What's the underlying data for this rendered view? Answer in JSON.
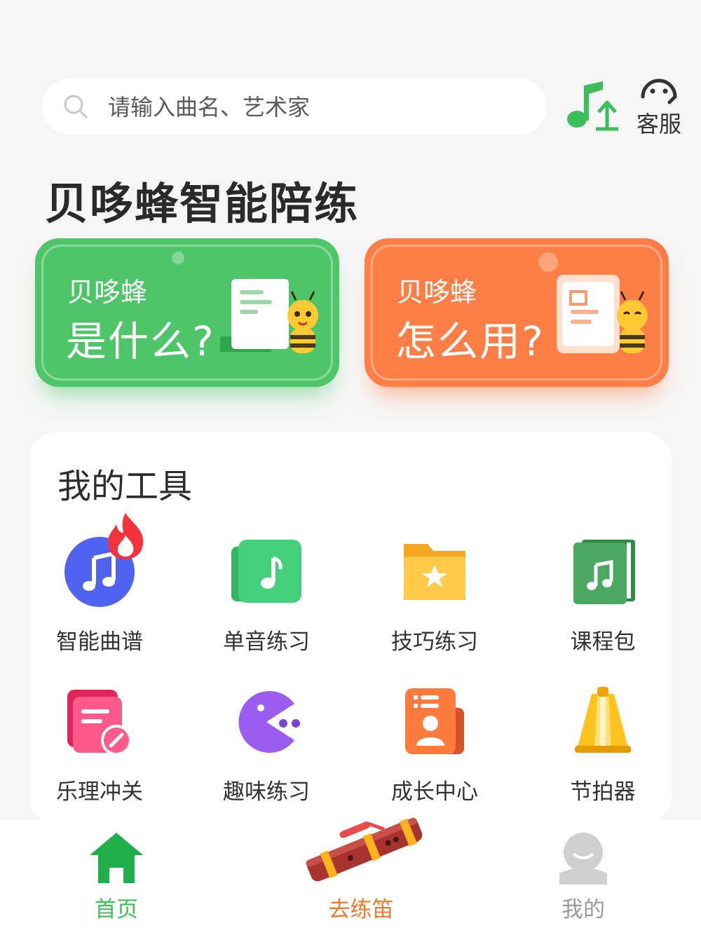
{
  "search": {
    "placeholder": "请输入曲名、艺术家"
  },
  "header": {
    "customer_service_label": "客服"
  },
  "page_title": "贝哆蜂智能陪练",
  "promo_cards": [
    {
      "sub": "贝哆蜂",
      "main": "是什么?",
      "color": "#4fc56a"
    },
    {
      "sub": "贝哆蜂",
      "main": "怎么用?",
      "color": "#ff7e45"
    }
  ],
  "tools": {
    "title": "我的工具",
    "items": [
      {
        "label": "智能曲谱",
        "icon": "music-note-hot-icon"
      },
      {
        "label": "单音练习",
        "icon": "green-note-card-icon"
      },
      {
        "label": "技巧练习",
        "icon": "star-folder-icon"
      },
      {
        "label": "课程包",
        "icon": "music-book-icon"
      },
      {
        "label": "乐理冲关",
        "icon": "edit-note-icon"
      },
      {
        "label": "趣味练习",
        "icon": "pacman-icon"
      },
      {
        "label": "成长中心",
        "icon": "profile-card-icon"
      },
      {
        "label": "节拍器",
        "icon": "metronome-icon"
      }
    ]
  },
  "nav": {
    "home": "首页",
    "practice": "去练笛",
    "mine": "我的"
  },
  "colors": {
    "accent": "#3cbf5a",
    "orange": "#f27a2a",
    "muted": "#9a9a9a"
  }
}
